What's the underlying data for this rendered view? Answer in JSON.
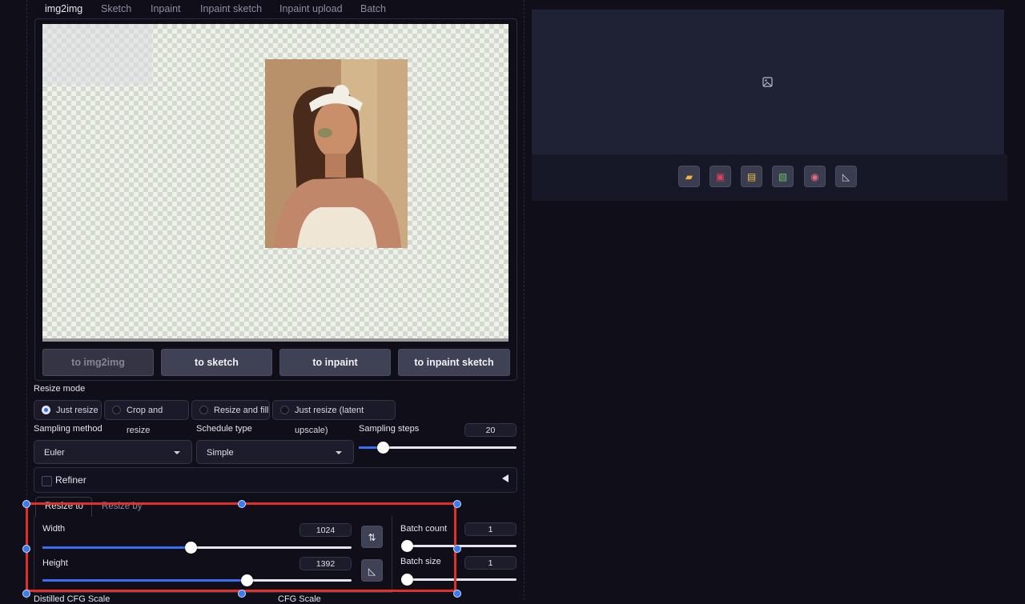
{
  "tabs": [
    "img2img",
    "Sketch",
    "Inpaint",
    "Inpaint sketch",
    "Inpaint upload",
    "Batch"
  ],
  "active_tab": "img2img",
  "send_buttons": [
    "to img2img",
    "to sketch",
    "to inpaint",
    "to inpaint sketch"
  ],
  "resize_mode": {
    "label": "Resize mode",
    "options": [
      "Just resize",
      "Crop and resize",
      "Resize and fill",
      "Just resize (latent upscale)"
    ],
    "selected": "Just resize"
  },
  "sampling_method": {
    "label": "Sampling method",
    "value": "Euler"
  },
  "schedule_type": {
    "label": "Schedule type",
    "value": "Simple"
  },
  "sampling_steps": {
    "label": "Sampling steps",
    "value": "20",
    "fraction": 0.15
  },
  "refiner": {
    "label": "Refiner"
  },
  "resize_tabs": [
    "Resize to",
    "Resize by"
  ],
  "width": {
    "label": "Width",
    "value": "1024",
    "fraction": 0.48
  },
  "height": {
    "label": "Height",
    "value": "1392",
    "fraction": 0.66
  },
  "batch_count": {
    "label": "Batch count",
    "value": "1",
    "fraction": 0.0
  },
  "batch_size": {
    "label": "Batch size",
    "value": "1",
    "fraction": 0.0
  },
  "bottom_labels": [
    "Distilled CFG Scale",
    "CFG Scale"
  ],
  "icons": {
    "swap": "swap-dimensions-icon",
    "aspect": "aspect-ratio-icon",
    "output_placeholder": "image-placeholder-icon",
    "output_tools": [
      "folder-icon",
      "save-icon",
      "zip-icon",
      "send-to-img2img-icon",
      "send-to-inpaint-icon",
      "send-to-extras-icon"
    ]
  },
  "colors": {
    "accent": "#3a6ef0",
    "highlight_box": "#e0302a",
    "background": "#0f0e19"
  }
}
